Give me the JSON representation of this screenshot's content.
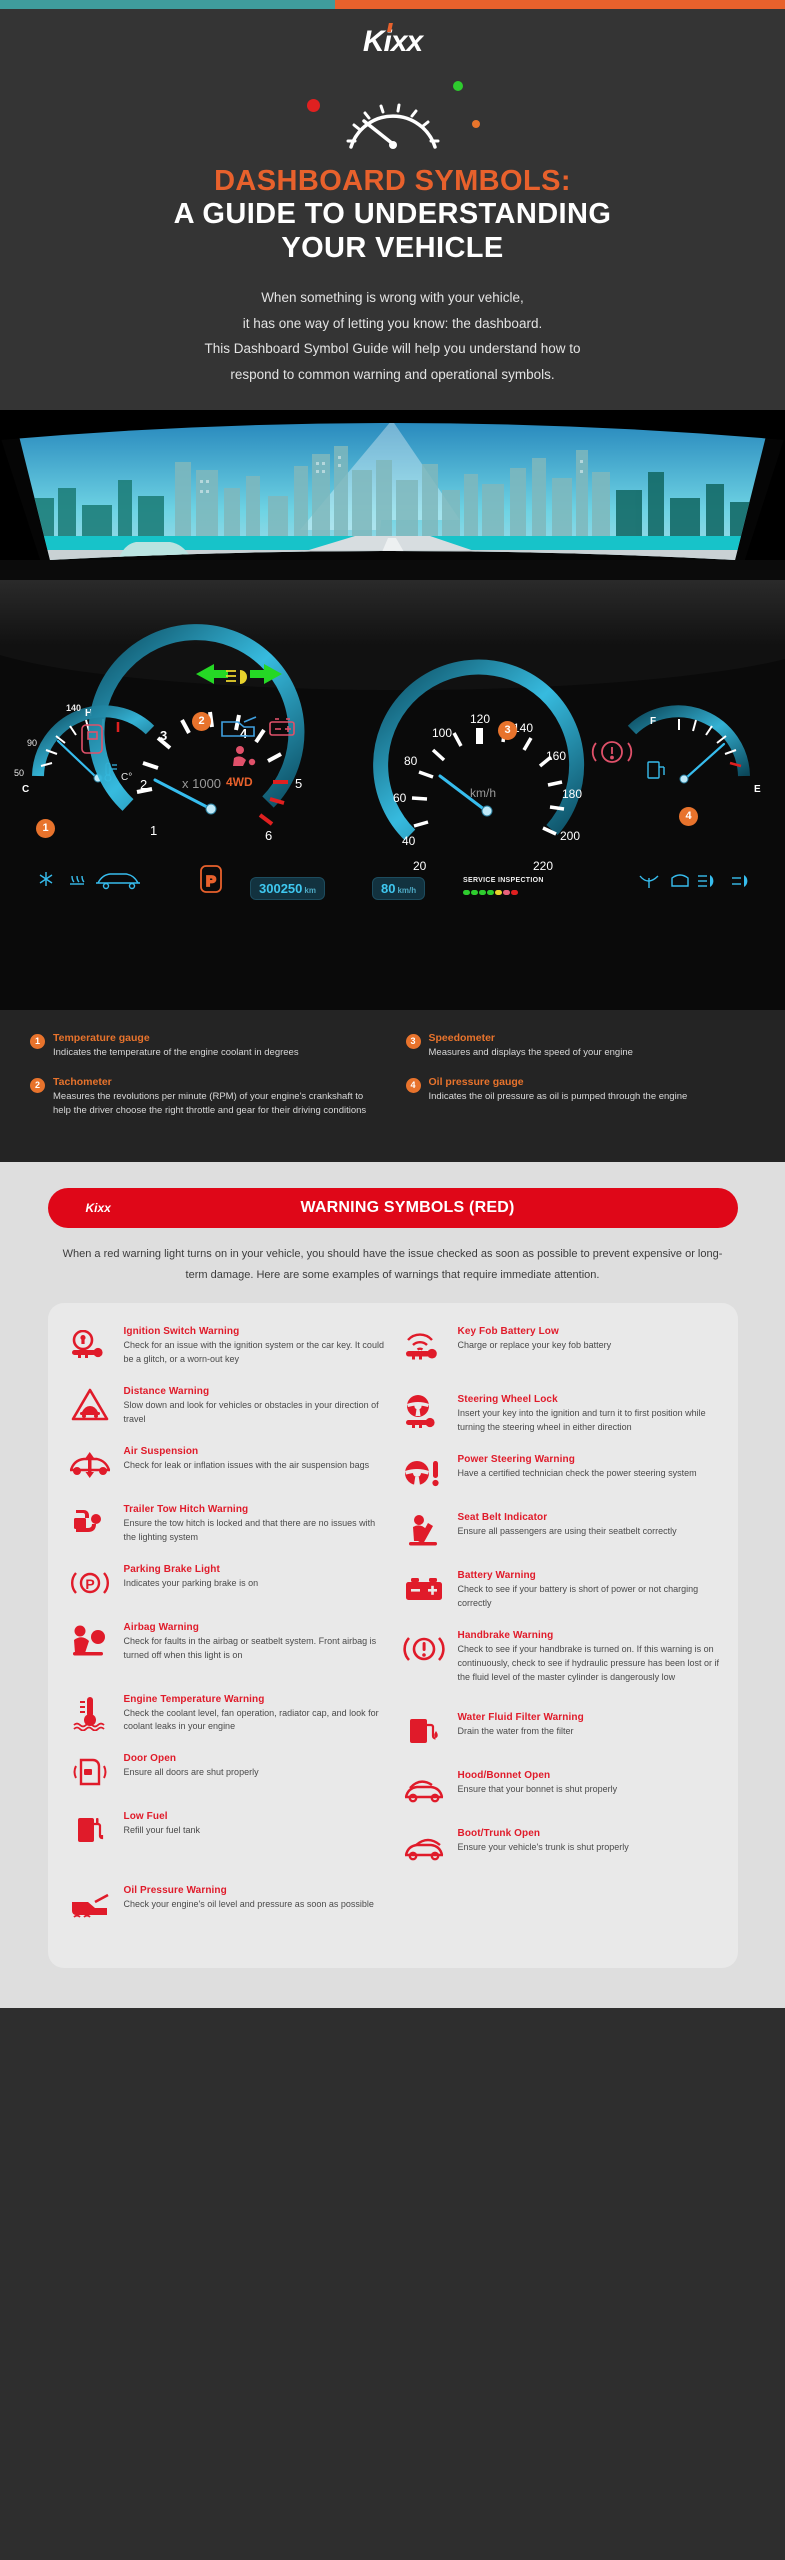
{
  "brand": {
    "name": "Kixx",
    "accent_orange": "#e8612c",
    "accent_red": "#df0718",
    "teal": "#3f9c9c"
  },
  "hero": {
    "title_line1": "DASHBOARD SYMBOLS:",
    "title_line2": "A GUIDE TO UNDERSTANDING",
    "title_line3": "YOUR VEHICLE",
    "intro_lines": [
      "When something is wrong with your vehicle,",
      "it has one way of letting you know: the dashboard.",
      "This Dashboard Symbol Guide will help you understand how to",
      "respond to common warning and operational symbols."
    ]
  },
  "dashboard": {
    "temp_gauge": {
      "labels": [
        "140",
        "H",
        "90",
        "50",
        "C"
      ],
      "icon": "coolant-temp-icon"
    },
    "tachometer": {
      "unit": "x 1000",
      "labels": [
        "1",
        "2",
        "3",
        "4",
        "5",
        "6"
      ]
    },
    "speedometer": {
      "unit": "km/h",
      "labels": [
        "20",
        "40",
        "60",
        "80",
        "100",
        "120",
        "140",
        "160",
        "180",
        "200",
        "220"
      ]
    },
    "fuel_gauge": {
      "labels": [
        "F",
        "E"
      ],
      "icon": "fuel-pump-icon"
    },
    "gear_indicator": "P",
    "odometer": {
      "value": "300250",
      "unit": "km"
    },
    "speed_display": {
      "value": "80",
      "unit": "km/h"
    },
    "service": {
      "label": "SERVICE INSPECTION",
      "colors": [
        "#2ecc2e",
        "#2ecc2e",
        "#2ecc2e",
        "#2ecc2e",
        "#e8d22c",
        "#e8607a",
        "#e02020"
      ]
    },
    "telltales": [
      "4WD"
    ],
    "markers": [
      "1",
      "2",
      "3",
      "4"
    ]
  },
  "legend": {
    "left": [
      {
        "num": "1",
        "title": "Temperature gauge",
        "desc": "Indicates the temperature of the engine coolant in degrees"
      },
      {
        "num": "2",
        "title": "Tachometer",
        "desc": "Measures the revolutions per minute (RPM) of your engine's crankshaft to help the driver choose the right throttle and gear for their driving conditions"
      }
    ],
    "right": [
      {
        "num": "3",
        "title": "Speedometer",
        "desc": "Measures and displays the speed of your engine"
      },
      {
        "num": "4",
        "title": "Oil pressure gauge",
        "desc": "Indicates the oil pressure as oil is pumped through the engine"
      }
    ]
  },
  "warning_section": {
    "banner_logo": "Kixx",
    "banner_title": "WARNING SYMBOLS (RED)",
    "lead": "When a red warning light turns on in your vehicle, you should have the issue checked as soon as possible to prevent expensive or long-term damage. Here are some examples of warnings that require immediate attention.",
    "left_items": [
      {
        "icon": "ignition-switch-icon",
        "title": "Ignition Switch Warning",
        "desc": "Check for an issue with the ignition system or the car key. It could be a glitch, or a worn-out key"
      },
      {
        "icon": "distance-warning-icon",
        "title": "Distance Warning",
        "desc": "Slow down and look for vehicles or obstacles in your direction of travel"
      },
      {
        "icon": "air-suspension-icon",
        "title": "Air Suspension",
        "desc": "Check for leak or inflation issues with the air suspension bags"
      },
      {
        "icon": "trailer-tow-hitch-icon",
        "title": "Trailer Tow Hitch Warning",
        "desc": "Ensure the tow hitch is locked and that there are no issues with the lighting system"
      },
      {
        "icon": "parking-brake-icon",
        "title": "Parking Brake Light",
        "desc": "Indicates your parking brake is on"
      },
      {
        "icon": "airbag-icon",
        "title": "Airbag Warning",
        "desc": "Check for faults in the airbag or seatbelt system. Front airbag is turned off when this light is on"
      },
      {
        "icon": "engine-temperature-icon",
        "title": "Engine Temperature Warning",
        "desc": "Check the coolant level, fan operation, radiator cap, and look for coolant leaks in your engine"
      },
      {
        "icon": "door-open-icon",
        "title": "Door Open",
        "desc": "Ensure all doors are shut properly"
      },
      {
        "icon": "low-fuel-icon",
        "title": "Low Fuel",
        "desc": "Refill your fuel tank"
      },
      {
        "icon": "oil-pressure-icon",
        "title": "Oil Pressure Warning",
        "desc": "Check your engine's oil level and pressure as soon as possible"
      }
    ],
    "right_items": [
      {
        "icon": "key-fob-battery-icon",
        "title": "Key Fob Battery Low",
        "desc": "Charge or replace your key fob battery"
      },
      {
        "icon": "steering-wheel-lock-icon",
        "title": "Steering Wheel Lock",
        "desc": "Insert your key into the ignition and turn it to first position while turning the steering wheel in either direction"
      },
      {
        "icon": "power-steering-icon",
        "title": "Power Steering Warning",
        "desc": "Have a certified technician check the power steering system"
      },
      {
        "icon": "seat-belt-icon",
        "title": "Seat Belt Indicator",
        "desc": "Ensure all passengers are using their seatbelt correctly"
      },
      {
        "icon": "battery-warning-icon",
        "title": "Battery Warning",
        "desc": "Check to see if your battery is short of power or not charging correctly"
      },
      {
        "icon": "handbrake-warning-icon",
        "title": "Handbrake Warning",
        "desc": "Check to see if your handbrake is turned on. If this warning is on continuously, check to see if hydraulic pressure has been lost or if the fluid level of the master cylinder is dangerously low"
      },
      {
        "icon": "water-fluid-filter-icon",
        "title": "Water Fluid Filter Warning",
        "desc": "Drain the water from the filter"
      },
      {
        "icon": "hood-bonnet-open-icon",
        "title": "Hood/Bonnet Open",
        "desc": "Ensure that your bonnet is shut properly"
      },
      {
        "icon": "boot-trunk-open-icon",
        "title": "Boot/Trunk Open",
        "desc": "Ensure your vehicle's trunk is shut properly"
      }
    ]
  }
}
